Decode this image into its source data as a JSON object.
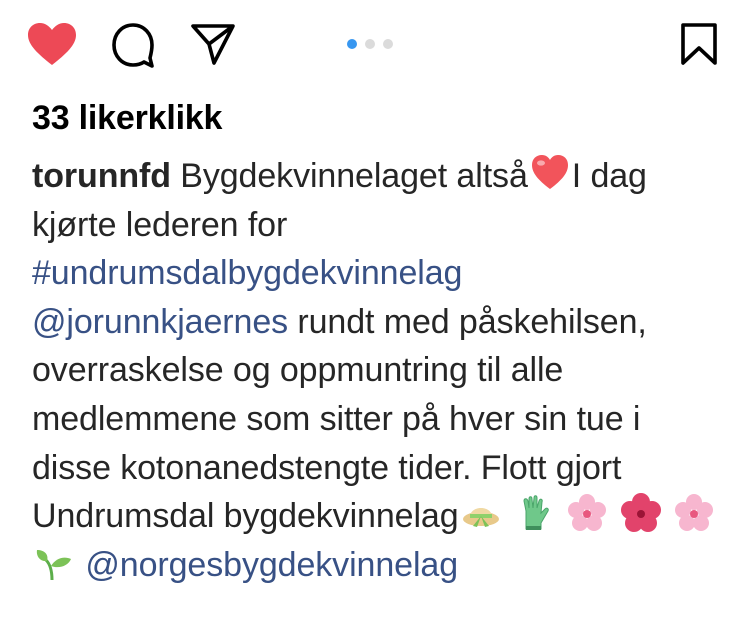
{
  "post": {
    "likes_text": "33 likerklikk",
    "carousel": {
      "slide_count": 3,
      "active_index": 0
    },
    "icons": {
      "like": "heart-icon",
      "comment": "comment-icon",
      "share": "paper-plane-icon",
      "save": "bookmark-icon"
    },
    "colors": {
      "liked_heart": "#ed4956",
      "link": "#385185",
      "active_dot": "#3897f0"
    }
  },
  "caption": {
    "username": "torunnfd",
    "text_1": " Bygdekvinnelaget altså",
    "emoji_heart": "red-heart-emoji",
    "text_2": "I dag kjørte lederen for ",
    "hashtag": "#undrumsdalbygdekvinnelag",
    "mention_1": "@jorunnkjaernes",
    "text_3": " rundt med påskehilsen, overraskelse og oppmuntring til alle medlemmene som sitter på hver sin tue i disse kotonanedstengte tider. Flott gjort Undrumsdal bygdekvinnelag",
    "emojis": [
      "hat-with-bow-emoji",
      "gloves-emoji",
      "cherry-blossom-emoji",
      "hibiscus-emoji",
      "cherry-blossom-emoji",
      "seedling-emoji"
    ],
    "mention_2": "@norgesbygdekvinnelag"
  }
}
